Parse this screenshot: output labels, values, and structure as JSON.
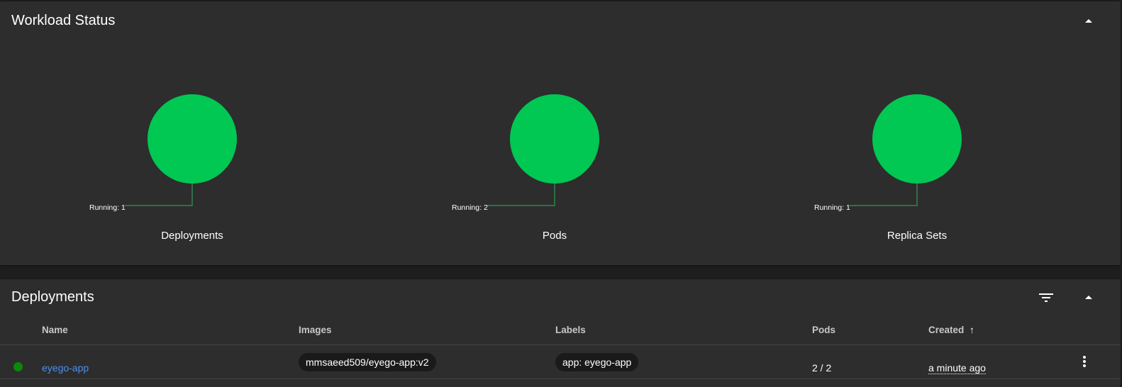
{
  "workload": {
    "title": "Workload Status",
    "charts": [
      {
        "name": "Deployments",
        "running_label": "Running: 1",
        "running": 1
      },
      {
        "name": "Pods",
        "running_label": "Running: 2",
        "running": 2
      },
      {
        "name": "Replica Sets",
        "running_label": "Running: 1",
        "running": 1
      }
    ],
    "running_color": "#00c853",
    "leader_color": "#2e9a57"
  },
  "deployments": {
    "title": "Deployments",
    "columns": [
      "Name",
      "Images",
      "Labels",
      "Pods",
      "Created"
    ],
    "sort_indicator": "↑",
    "rows": [
      {
        "status": "running",
        "name": "eyego-app",
        "image": "mmsaeed509/eyego-app:v2",
        "label": "app: eyego-app",
        "pods": "2 / 2",
        "created": "a minute ago"
      }
    ]
  },
  "colors": {
    "background": "#1e1e1e",
    "card": "#2d2d2d",
    "link": "#4a8ff0",
    "status_ok": "#0a8a0a"
  },
  "icons": {
    "collapse": "chevron-up-icon",
    "filter": "filter-icon",
    "more": "more-vert-icon"
  }
}
